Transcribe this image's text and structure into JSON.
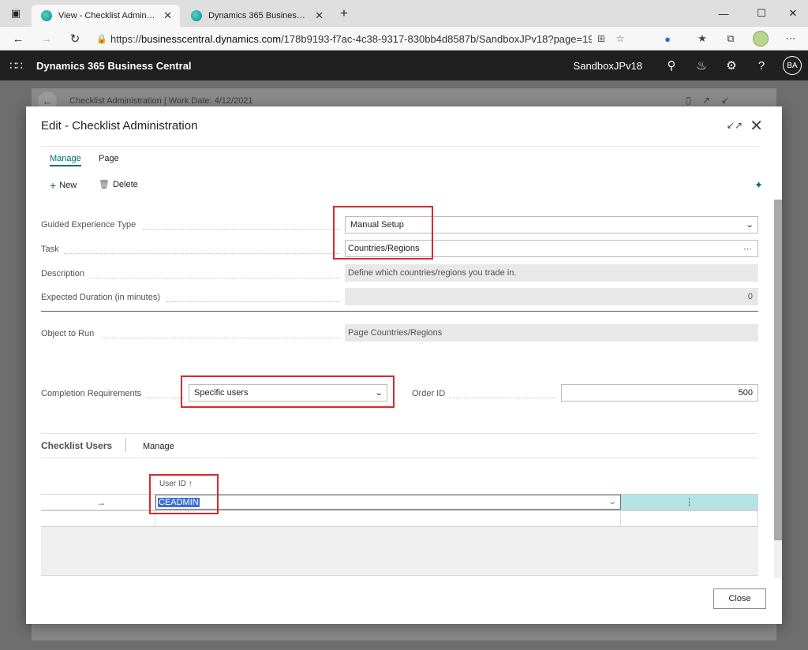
{
  "browser": {
    "tabs": [
      {
        "label": "View - Checklist Administration -"
      },
      {
        "label": "Dynamics 365 Business Central"
      }
    ],
    "url_prefix": "https://",
    "url_host": "businesscentral.dynamics.com",
    "url_rest": "/178b9193-f7ac-4c38-9317-830bb4d8587b/SandboxJPv18?page=19..."
  },
  "appbar": {
    "title": "Dynamics 365 Business Central",
    "environment": "SandboxJPv18",
    "avatar": "BA"
  },
  "background": {
    "title": "Checklist Administration | Work Date: 4/12/2021"
  },
  "dialog": {
    "title": "Edit - Checklist Administration",
    "menu": [
      "Manage",
      "Page"
    ],
    "actions": {
      "new": "New",
      "delete": "Delete"
    },
    "fields": {
      "guided_type_label": "Guided Experience Type",
      "guided_type_value": "Manual Setup",
      "task_label": "Task",
      "task_value": "Countries/Regions",
      "description_label": "Description",
      "description_value": "Define which countries/regions you trade in.",
      "duration_label": "Expected Duration (in minutes)",
      "duration_value": "0",
      "object_label": "Object to Run",
      "object_value": "Page Countries/Regions",
      "completion_label": "Completion Requirements",
      "completion_value": "Specific users",
      "order_label": "Order ID",
      "order_value": "500"
    },
    "part": {
      "title": "Checklist Users",
      "menu": "Manage",
      "column": "User ID ↑",
      "rows": [
        {
          "user_id": "CEADMIN"
        }
      ]
    },
    "close_label": "Close"
  },
  "colors": {
    "accent": "#00706b",
    "highlight": "#d9282f",
    "appbar": "#202020"
  }
}
